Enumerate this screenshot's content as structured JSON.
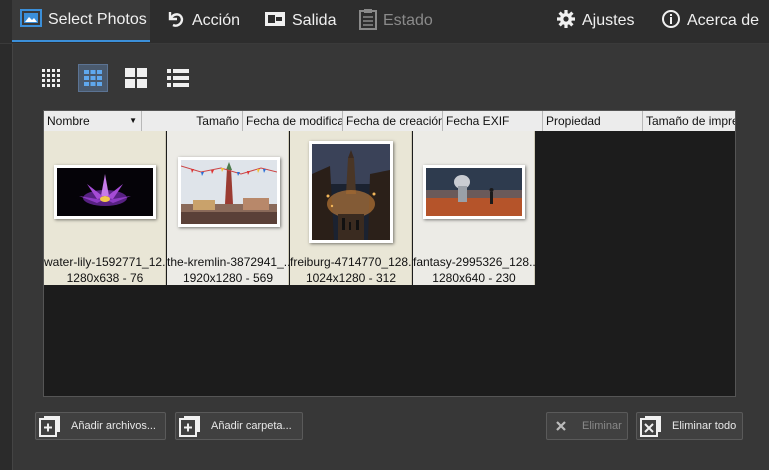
{
  "toolbar": {
    "tabs": [
      {
        "label": "Select Photos",
        "icon": "select-photos-icon"
      },
      {
        "label": "Acción",
        "icon": "action-icon"
      },
      {
        "label": "Salida",
        "icon": "output-icon"
      },
      {
        "label": "Estado",
        "icon": "status-icon"
      }
    ],
    "settings_label": "Ajustes",
    "about_label": "Acerca de"
  },
  "columns": [
    "Nombre",
    "Tamaño",
    "Fecha de modifica",
    "Fecha de creación",
    "Fecha EXIF",
    "Propiedad",
    "Tamaño de impre"
  ],
  "files": [
    {
      "name": "water-lily-1592771_12...",
      "info": "1280x638 - 76"
    },
    {
      "name": "the-kremlin-3872941_...",
      "info": "1920x1280 - 569"
    },
    {
      "name": "freiburg-4714770_128...",
      "info": "1024x1280 - 312"
    },
    {
      "name": "fantasy-2995326_128...",
      "info": "1280x640 - 230"
    }
  ],
  "buttons": {
    "add_files": "Añadir archivos...",
    "add_folder": "Añadir carpeta...",
    "remove": "Eliminar",
    "remove_all": "Eliminar todo"
  },
  "colors": {
    "accent": "#3b8fd9",
    "background": "#2b2b2b",
    "list_bg": "#1c1c1c"
  }
}
